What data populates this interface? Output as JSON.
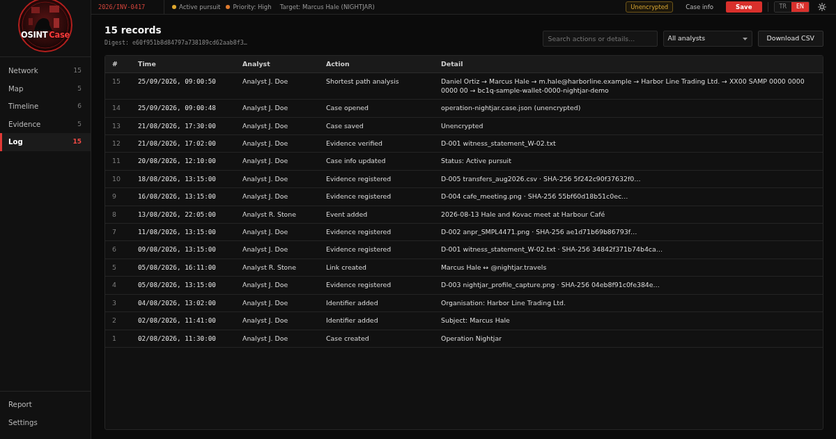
{
  "sidebar": {
    "logo": {
      "text": "OSINT",
      "accent": "Case"
    },
    "nav": [
      {
        "label": "Network",
        "count": "15",
        "selected": false
      },
      {
        "label": "Map",
        "count": "5",
        "selected": false
      },
      {
        "label": "Timeline",
        "count": "6",
        "selected": false
      },
      {
        "label": "Evidence",
        "count": "5",
        "selected": false
      },
      {
        "label": "Log",
        "count": "15",
        "selected": true
      }
    ],
    "footer_links": [
      "Report",
      "Settings"
    ]
  },
  "top_bar": {
    "case_number": "2026/INV-0417",
    "statuses": [
      {
        "label": "Active pursuit",
        "color": "#e0a82e"
      },
      {
        "label": "Priority: High",
        "color": "#e07b2f"
      }
    ],
    "target": "Target: Marcus Hale (NIGHTJAR)",
    "encryption_badge": "Unencrypted",
    "case_info_button": "Case info",
    "save_button": "Save",
    "languages": [
      {
        "label": "TR",
        "selected": false
      },
      {
        "label": "EN",
        "selected": true
      }
    ]
  },
  "log": {
    "title": "15 records",
    "digest": "Digest: e60f951b8d84797a738189cd62aab8f3…",
    "search": {
      "placeholder": "Search actions or details..."
    },
    "analyst_filter": {
      "value": "All analysts"
    },
    "download_button": "Download CSV",
    "table": {
      "columns": [
        "#",
        "Time",
        "Analyst",
        "Action",
        "Detail"
      ],
      "rows": [
        [
          "15",
          "25/09/2026, 09:00:50",
          "Analyst J. Doe",
          "Shortest path analysis",
          "Daniel Ortiz → Marcus Hale → m.hale@harborline.example → Harbor Line Trading Ltd. → XX00 SAMP 0000 0000 0000 00 → bc1q-sample-wallet-0000-nightjar-demo"
        ],
        [
          "14",
          "25/09/2026, 09:00:48",
          "Analyst J. Doe",
          "Case opened",
          "operation-nightjar.case.json (unencrypted)"
        ],
        [
          "13",
          "21/08/2026, 17:30:00",
          "Analyst J. Doe",
          "Case saved",
          "Unencrypted"
        ],
        [
          "12",
          "21/08/2026, 17:02:00",
          "Analyst J. Doe",
          "Evidence verified",
          "D-001 witness_statement_W-02.txt"
        ],
        [
          "11",
          "20/08/2026, 12:10:00",
          "Analyst J. Doe",
          "Case info updated",
          "Status: Active pursuit"
        ],
        [
          "10",
          "18/08/2026, 13:15:00",
          "Analyst J. Doe",
          "Evidence registered",
          "D-005 transfers_aug2026.csv · SHA-256 5f242c90f37632f0…"
        ],
        [
          "9",
          "16/08/2026, 13:15:00",
          "Analyst J. Doe",
          "Evidence registered",
          "D-004 cafe_meeting.png · SHA-256 55bf60d18b51c0ec…"
        ],
        [
          "8",
          "13/08/2026, 22:05:00",
          "Analyst R. Stone",
          "Event added",
          "2026-08-13 Hale and Kovac meet at Harbour Café"
        ],
        [
          "7",
          "11/08/2026, 13:15:00",
          "Analyst J. Doe",
          "Evidence registered",
          "D-002 anpr_SMPL4471.png · SHA-256 ae1d71b69b86793f…"
        ],
        [
          "6",
          "09/08/2026, 13:15:00",
          "Analyst J. Doe",
          "Evidence registered",
          "D-001 witness_statement_W-02.txt · SHA-256 34842f371b74b4ca…"
        ],
        [
          "5",
          "05/08/2026, 16:11:00",
          "Analyst R. Stone",
          "Link created",
          "Marcus Hale ↔ @nightjar.travels"
        ],
        [
          "4",
          "05/08/2026, 13:15:00",
          "Analyst J. Doe",
          "Evidence registered",
          "D-003 nightjar_profile_capture.png · SHA-256 04eb8f91c0fe384e…"
        ],
        [
          "3",
          "04/08/2026, 13:02:00",
          "Analyst J. Doe",
          "Identifier added",
          "Organisation: Harbor Line Trading Ltd."
        ],
        [
          "2",
          "02/08/2026, 11:41:00",
          "Analyst J. Doe",
          "Identifier added",
          "Subject: Marcus Hale"
        ],
        [
          "1",
          "02/08/2026, 11:30:00",
          "Analyst J. Doe",
          "Case created",
          "Operation Nightjar"
        ]
      ]
    }
  }
}
